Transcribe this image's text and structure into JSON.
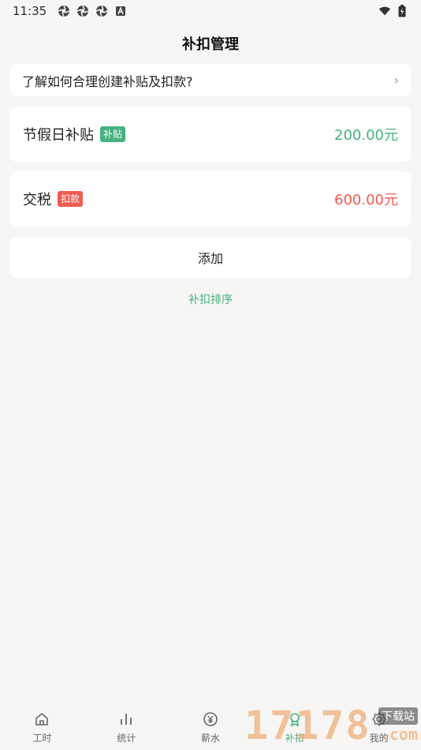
{
  "status": {
    "time": "11:35",
    "left_icons": [
      "aperture-icon",
      "aperture-icon",
      "aperture-icon",
      "a-box-icon"
    ],
    "right_icons": [
      "wifi-icon",
      "battery-icon"
    ]
  },
  "header": {
    "title": "补扣管理"
  },
  "help": {
    "text": "了解如何合理创建补贴及扣款?",
    "chevron": "›"
  },
  "items": [
    {
      "name": "节假日补贴",
      "tag": "补贴",
      "amount": "200.00元",
      "color": "#45b27e"
    },
    {
      "name": "交税",
      "tag": "扣款",
      "amount": "600.00元",
      "color": "#ef5b4f"
    }
  ],
  "actions": {
    "add_label": "添加",
    "sort_label": "补扣排序"
  },
  "tabbar": {
    "tabs": [
      {
        "label": "工时",
        "icon": "home-icon"
      },
      {
        "label": "统计",
        "icon": "bar-chart-icon"
      },
      {
        "label": "薪水",
        "icon": "yuan-icon"
      },
      {
        "label": "补扣",
        "icon": "badge-icon"
      },
      {
        "label": "我的",
        "icon": "gear-icon"
      }
    ],
    "active_index": 3
  },
  "watermark": {
    "number": "17178",
    "top": "下载站",
    "bottom": ".com"
  },
  "colors": {
    "accent": "#45b27e",
    "danger": "#ef5b4f",
    "background": "#f7f6f4"
  }
}
